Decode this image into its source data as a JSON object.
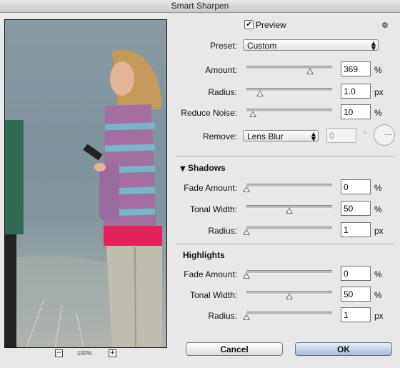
{
  "window": {
    "title": "Smart Sharpen"
  },
  "preview": {
    "checkbox_label": "Preview",
    "checked_glyph": "✔",
    "zoom_level": "100%",
    "zoom_out_glyph": "−",
    "zoom_in_glyph": "+"
  },
  "settings_icon": "gear-icon",
  "preset": {
    "label": "Preset:",
    "value": "Custom"
  },
  "amount": {
    "label": "Amount:",
    "value": "369",
    "unit": "%",
    "level": 0.74
  },
  "radius": {
    "label": "Radius:",
    "value": "1.0",
    "unit": "px",
    "level": 0.15
  },
  "reduce_noise": {
    "label": "Reduce Noise:",
    "value": "10",
    "unit": "%",
    "level": 0.08
  },
  "remove": {
    "label": "Remove:",
    "value": "Lens Blur",
    "angle_value": "0",
    "angle_unit": "°"
  },
  "shadows": {
    "header": "Shadows",
    "toggle_glyph": "▼",
    "fade_amount": {
      "label": "Fade Amount:",
      "value": "0",
      "unit": "%",
      "level": 0.0
    },
    "tonal_width": {
      "label": "Tonal Width:",
      "value": "50",
      "unit": "%",
      "level": 0.5
    },
    "radius": {
      "label": "Radius:",
      "value": "1",
      "unit": "px",
      "level": 0.0
    }
  },
  "highlights": {
    "header": "Highlights",
    "fade_amount": {
      "label": "Fade Amount:",
      "value": "0",
      "unit": "%",
      "level": 0.0
    },
    "tonal_width": {
      "label": "Tonal Width:",
      "value": "50",
      "unit": "%",
      "level": 0.5
    },
    "radius": {
      "label": "Radius:",
      "value": "1",
      "unit": "px",
      "level": 0.0
    }
  },
  "buttons": {
    "cancel": "Cancel",
    "ok": "OK"
  }
}
